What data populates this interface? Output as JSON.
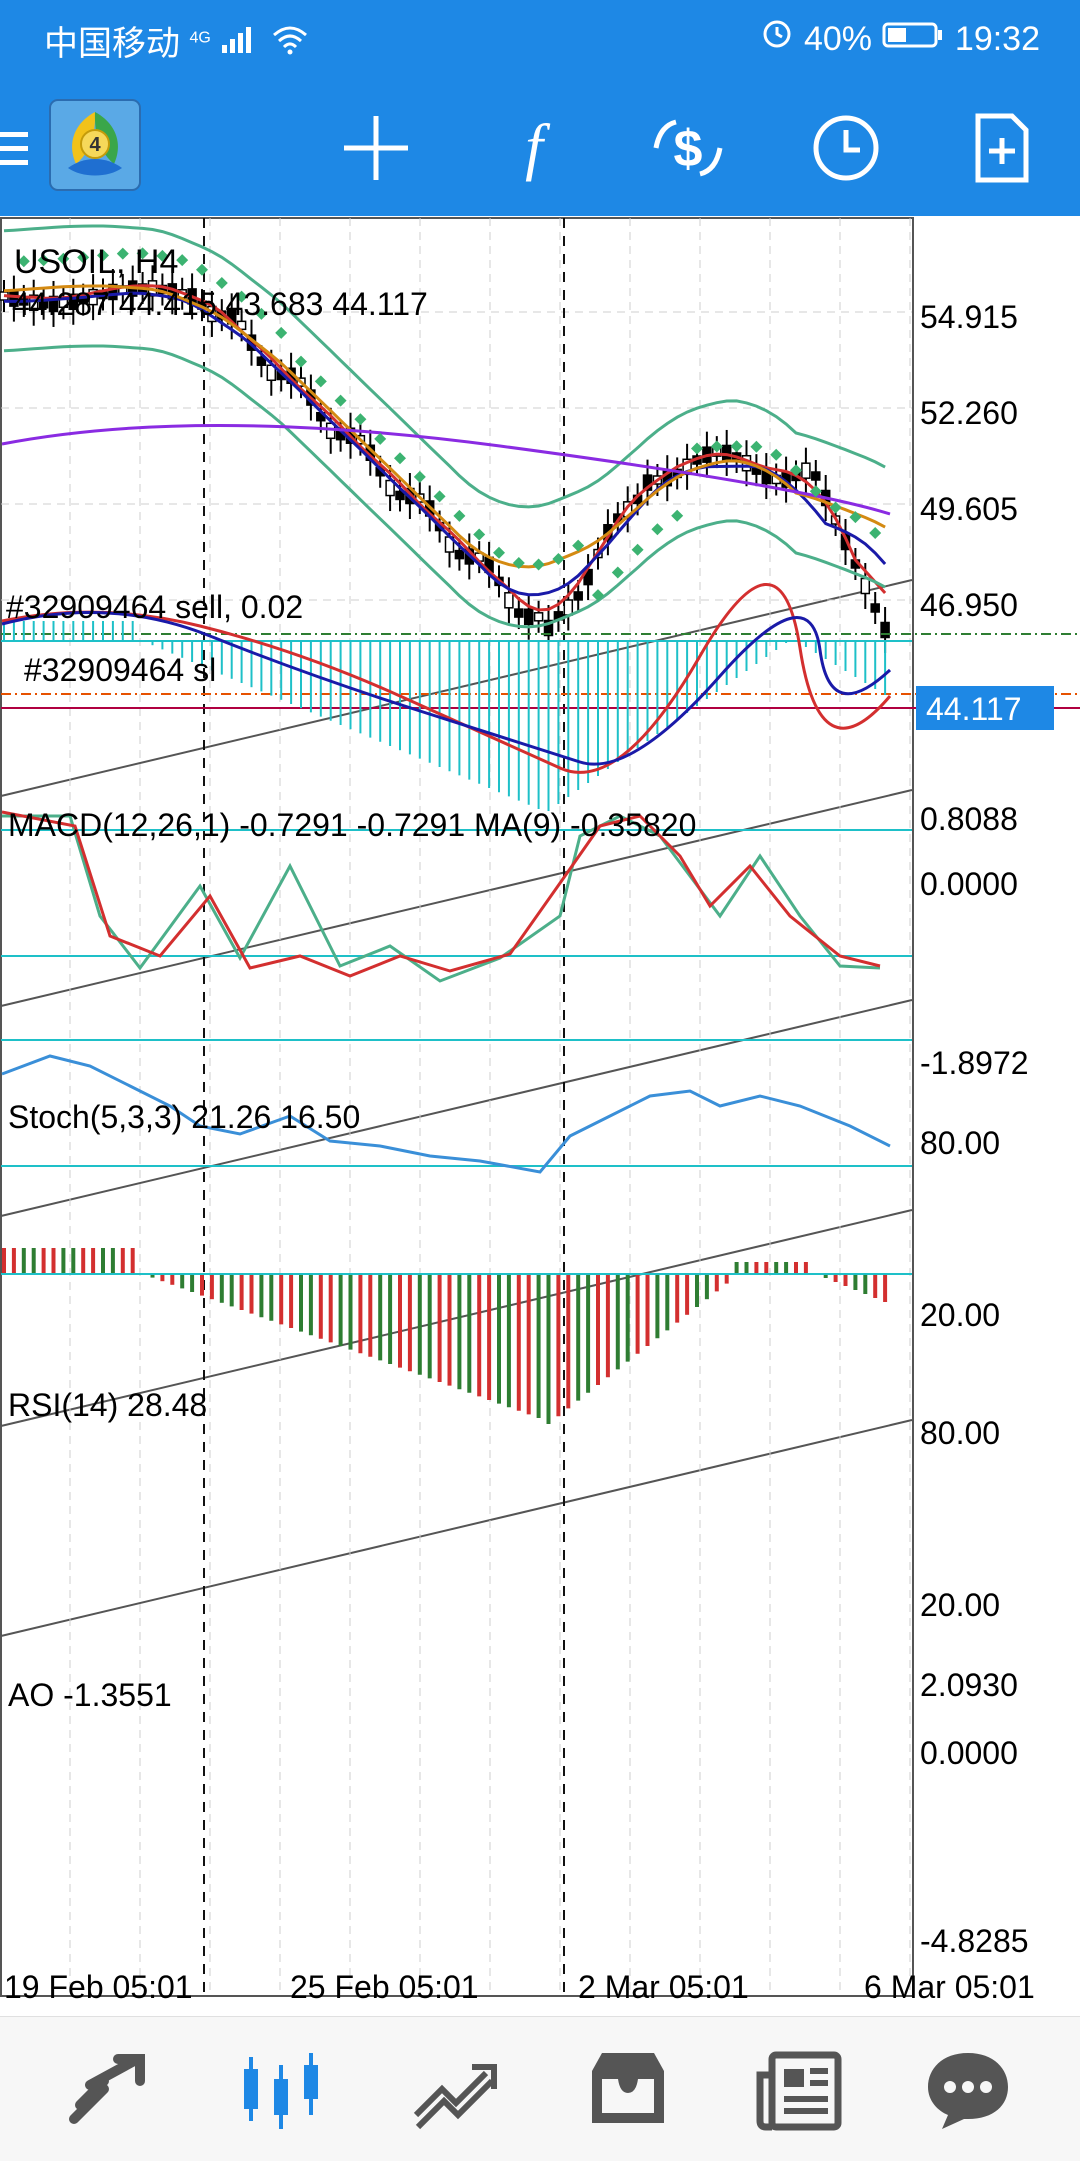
{
  "status_bar": {
    "carrier": "中国移动",
    "network": "4G",
    "battery": "40%",
    "time": "19:32"
  },
  "toolbar": {
    "icons": [
      "menu-icon",
      "metatrader-logo",
      "crosshair-icon",
      "function-icon",
      "trade-icon",
      "clock-icon",
      "new-document-icon"
    ]
  },
  "chart": {
    "symbol": "USOIL, H4",
    "ohlc": "44.287 44.415 43.683 44.117",
    "order_label": "#32909464 sell, 0.02",
    "sl_label": "#32909464 sl",
    "price_levels": [
      "54.915",
      "52.260",
      "49.605",
      "46.950"
    ],
    "current_price": "44.117",
    "time_labels": [
      "19 Feb 05:01",
      "25 Feb 05:01",
      "2 Mar 05:01",
      "6 Mar 05:01"
    ]
  },
  "macd": {
    "label": "MACD(12,26,1) -0.7291 -0.7291 MA(9) -0.35820",
    "levels": [
      "0.8088",
      "0.0000",
      "-1.8972"
    ]
  },
  "stoch": {
    "label": "Stoch(5,3,3) 21.26 16.50",
    "levels": [
      "80.00",
      "20.00"
    ]
  },
  "rsi": {
    "label": "RSI(14) 28.48",
    "levels": [
      "80.00",
      "20.00"
    ]
  },
  "ao": {
    "label": "AO -1.3551",
    "levels": [
      "2.0930",
      "0.0000",
      "-4.8285"
    ]
  },
  "bottom_nav": {
    "items": [
      "quotes-icon",
      "chart-icon",
      "trade-icon",
      "history-icon",
      "news-icon",
      "chat-icon"
    ]
  },
  "colors": {
    "header_blue": "#1e88e5",
    "bull_candle": "#ffffff",
    "bear_candle": "#000000",
    "ma_red": "#d32f2f",
    "ma_blue": "#1a1aa8",
    "ma_orange": "#d48a12",
    "ma_purple": "#8a2be2",
    "bands_green": "#4caf8a",
    "sar_green": "#3cb371",
    "cyan": "#1ec0c8",
    "price_tag": "#1e88e5"
  }
}
